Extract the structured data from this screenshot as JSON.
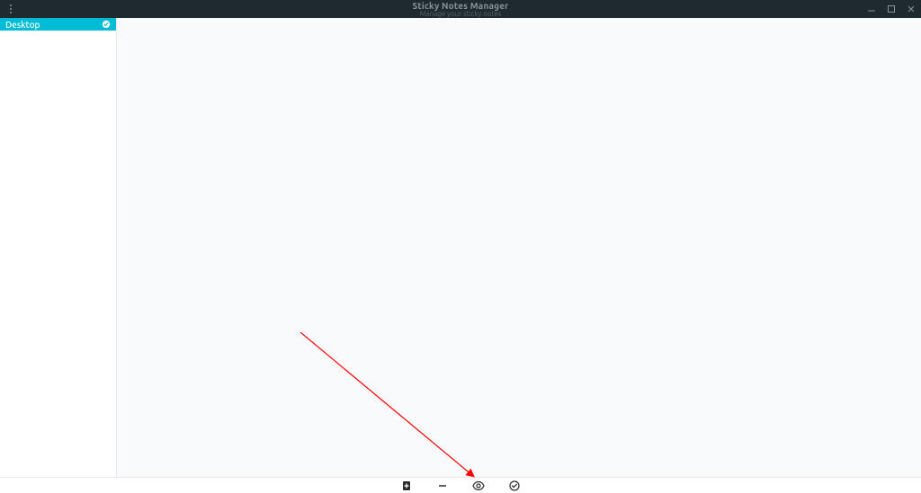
{
  "titlebar": {
    "title": "Sticky Notes Manager",
    "subtitle": "Manage your sticky notes"
  },
  "sidebar": {
    "items": [
      {
        "label": "Desktop"
      }
    ]
  },
  "bottombar": {
    "new_note": "new",
    "remove": "remove",
    "preview": "preview",
    "apply": "apply"
  },
  "annotation": {
    "arrow_target": "new-note-button"
  }
}
